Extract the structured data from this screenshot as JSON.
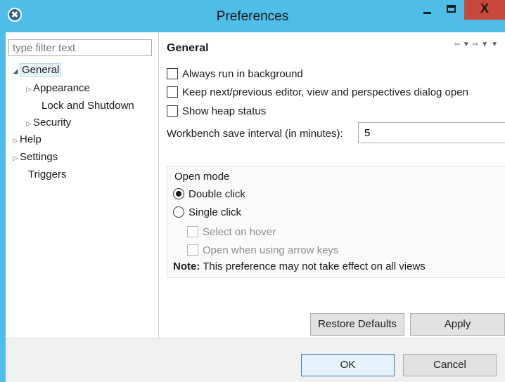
{
  "window": {
    "title": "Preferences"
  },
  "titlebar": {
    "close_glyph": "X"
  },
  "filter": {
    "placeholder": "type filter text"
  },
  "tree": {
    "general": "General",
    "appearance": "Appearance",
    "lock_and_shutdown": "Lock and Shutdown",
    "security": "Security",
    "help": "Help",
    "settings": "Settings",
    "triggers": "Triggers"
  },
  "page": {
    "title": "General",
    "always_run_in_background": "Always run in background",
    "keep_dialog_open": "Keep next/previous editor, view and perspectives dialog open",
    "show_heap_status": "Show heap status",
    "save_interval_label": "Workbench save interval (in minutes):",
    "save_interval_value": "5",
    "open_mode": {
      "label": "Open mode",
      "double_click": "Double click",
      "single_click": "Single click",
      "select_on_hover": "Select on hover",
      "open_with_arrow_keys": "Open when using arrow keys",
      "note_bold": "Note:",
      "note_text": " This preference may not take effect on all views"
    },
    "restore_defaults": "Restore Defaults",
    "apply": "Apply"
  },
  "dialog": {
    "ok": "OK",
    "cancel": "Cancel"
  },
  "icons": {
    "app": "app-logo-icon",
    "back": "back-arrow-icon",
    "forward": "forward-arrow-icon",
    "menu": "view-menu-icon"
  }
}
